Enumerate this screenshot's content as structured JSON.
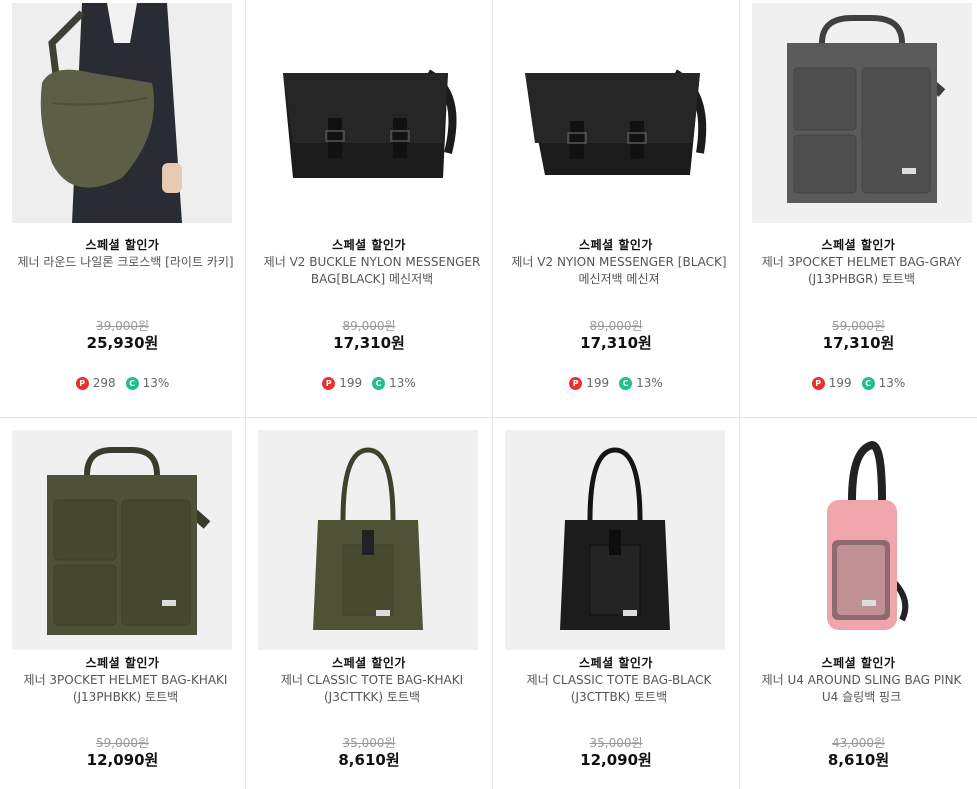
{
  "products": [
    {
      "badge": "스페셜 할인가",
      "name": "제너 라운드 나일론 크로스백 [라이트 카키]",
      "orig": "39,000원",
      "price": "25,930원",
      "points": "298",
      "coupon": "13%",
      "color": "#5c5f46",
      "type": "sling"
    },
    {
      "badge": "스페셜 할인가",
      "name": "제너 V2 BUCKLE NYLON MESSENGER BAG[BLACK] 메신저백",
      "orig": "89,000원",
      "price": "17,310원",
      "points": "199",
      "coupon": "13%",
      "color": "#1b1b1b",
      "type": "messenger"
    },
    {
      "badge": "스페셜 할인가",
      "name": "제너 V2 NYION MESSENGER [BLACK] 메신저백 메신져",
      "orig": "89,000원",
      "price": "17,310원",
      "points": "199",
      "coupon": "13%",
      "color": "#1b1b1b",
      "type": "messenger"
    },
    {
      "badge": "스페셜 할인가",
      "name": "제너 3POCKET HELMET BAG-GRAY (J13PHBGR) 토트백",
      "orig": "59,000원",
      "price": "17,310원",
      "points": "199",
      "coupon": "13%",
      "color": "#5a5a5a",
      "type": "helmet"
    },
    {
      "badge": "스페셜 할인가",
      "name": "제너 3POCKET HELMET BAG-KHAKI (J13PHBKK) 토트백",
      "orig": "59,000원",
      "price": "12,090원",
      "color": "#4e5138",
      "type": "helmet"
    },
    {
      "badge": "스페셜 할인가",
      "name": "제너 CLASSIC TOTE BAG-KHAKI (J3CTTKK) 토트백",
      "orig": "35,000원",
      "price": "8,610원",
      "color": "#4f5234",
      "type": "tote"
    },
    {
      "badge": "스페셜 할인가",
      "name": "제너 CLASSIC TOTE BAG-BLACK (J3CTTBK) 토트백",
      "orig": "35,000원",
      "price": "12,090원",
      "color": "#1c1c1c",
      "type": "tote"
    },
    {
      "badge": "스페셜 할인가",
      "name": "제너 U4 AROUND SLING BAG PINK U4 슬링백 핑크",
      "orig": "43,000원",
      "price": "8,610원",
      "color": "#f0a5ad",
      "type": "sling-pink"
    }
  ]
}
